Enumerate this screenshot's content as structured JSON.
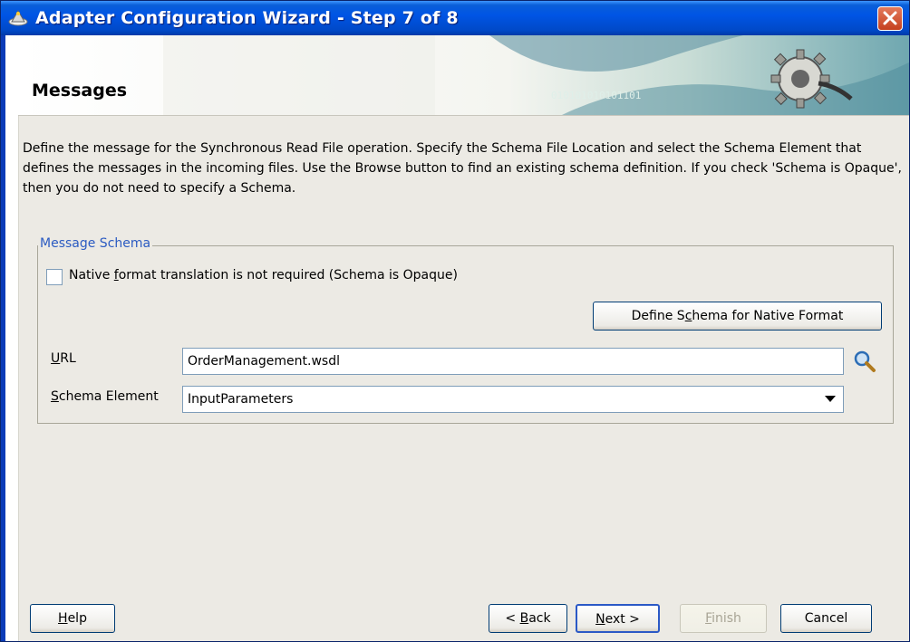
{
  "window": {
    "title": "Adapter Configuration Wizard - Step 7 of 8",
    "close_label": "Close"
  },
  "header": {
    "title": "Messages",
    "banner_binary": "010101010101101"
  },
  "description": "Define the message for the Synchronous Read File operation.  Specify the Schema File Location and select the Schema Element that defines the messages in the incoming files. Use the Browse button to find an existing schema definition. If you check 'Schema is Opaque', then you do not need to specify a Schema.",
  "message_schema": {
    "legend": "Message Schema",
    "opaque_checkbox": {
      "label_before": "Native ",
      "label_mnemonic": "f",
      "label_after": "ormat translation is not required (Schema is Opaque)",
      "checked": false
    },
    "define_button": {
      "before": "Define S",
      "mnemonic": "c",
      "after": "hema for Native Format"
    },
    "url_label": {
      "mnemonic": "U",
      "after": "RL"
    },
    "url_value": "OrderManagement.wsdl",
    "schema_element_label": {
      "mnemonic": "S",
      "after": "chema Element"
    },
    "schema_element_value": "InputParameters"
  },
  "footer": {
    "help": {
      "mnemonic": "H",
      "after": "elp"
    },
    "back": {
      "before": "< ",
      "mnemonic": "B",
      "after": "ack"
    },
    "next": {
      "mnemonic": "N",
      "after": "ext >"
    },
    "finish": {
      "mnemonic": "F",
      "after": "inish",
      "enabled": false
    },
    "cancel": "Cancel"
  },
  "colors": {
    "titlebar": "#0055e5",
    "legend": "#2b5bc2",
    "dialog_bg": "#eceae4"
  }
}
